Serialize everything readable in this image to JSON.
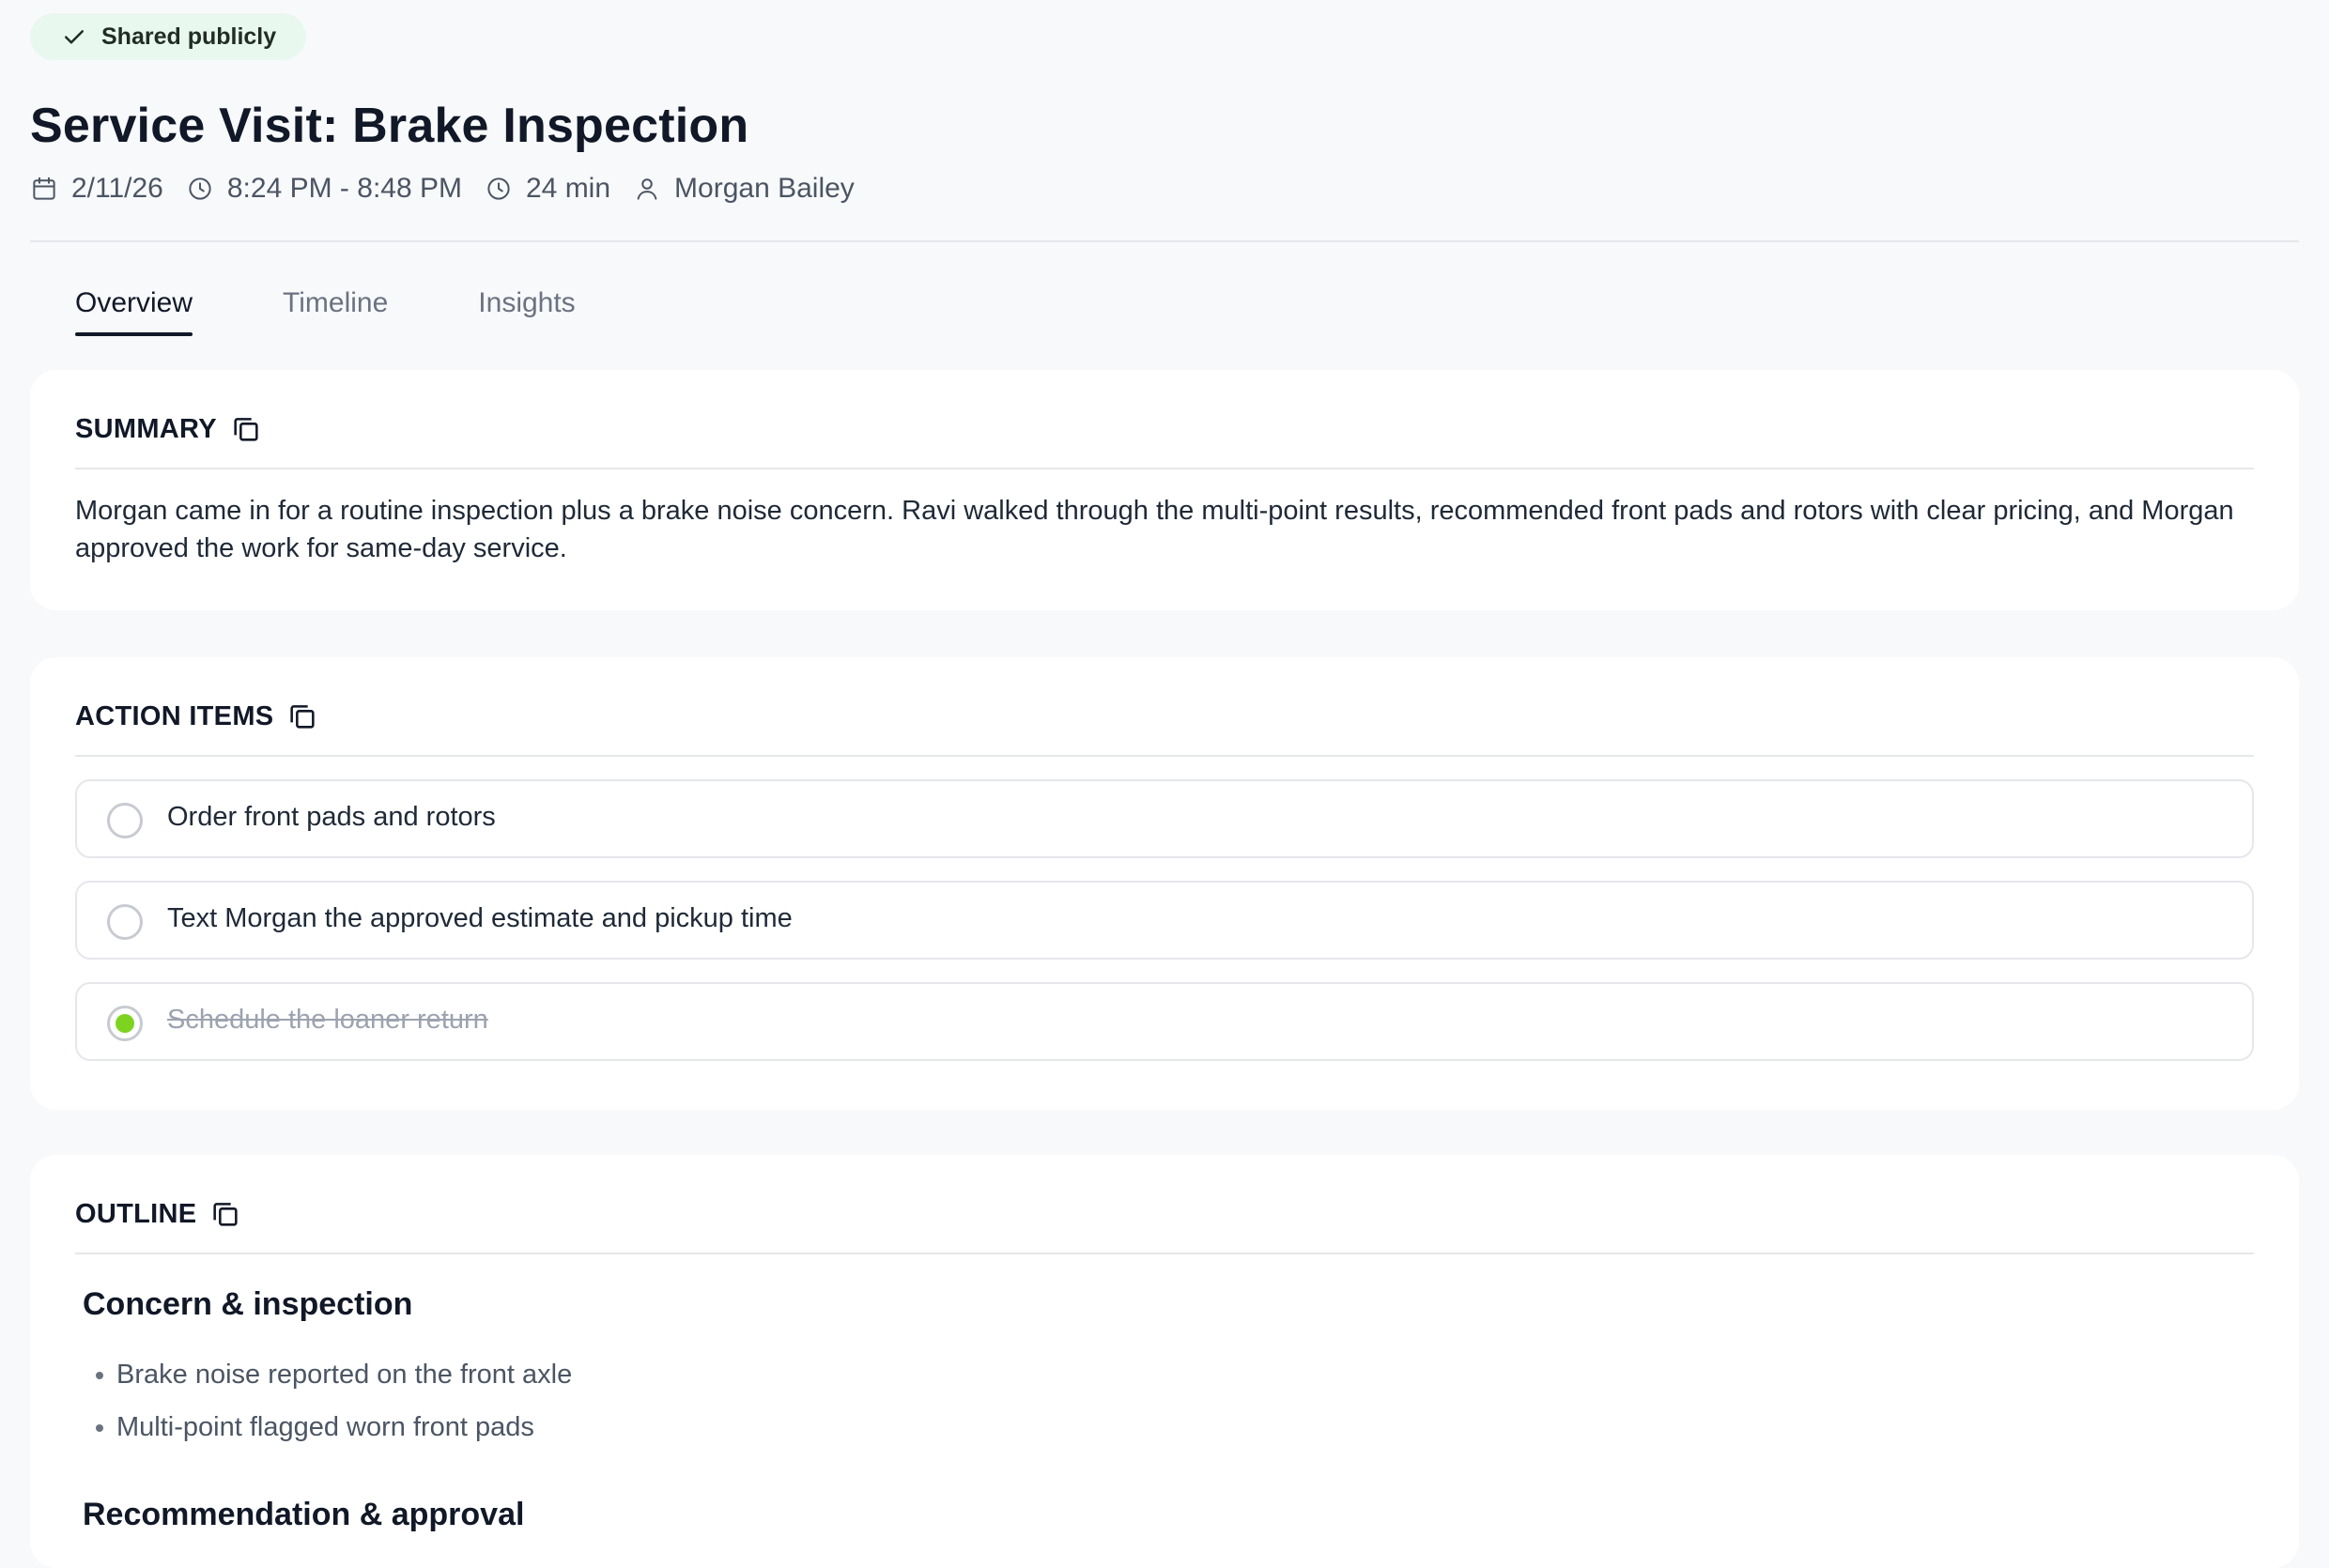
{
  "badge": {
    "label": "Shared publicly"
  },
  "title": "Service Visit: Brake Inspection",
  "meta": {
    "date": "2/11/26",
    "time_range": "8:24 PM - 8:48 PM",
    "duration": "24 min",
    "person": "Morgan Bailey"
  },
  "tabs": [
    {
      "label": "Overview",
      "active": true
    },
    {
      "label": "Timeline",
      "active": false
    },
    {
      "label": "Insights",
      "active": false
    }
  ],
  "summary": {
    "title": "SUMMARY",
    "text": "Morgan came in for a routine inspection plus a brake noise concern. Ravi walked through the multi-point results, recommended front pads and rotors with clear pricing, and Morgan approved the work for same-day service."
  },
  "action_items": {
    "title": "ACTION ITEMS",
    "items": [
      {
        "label": "Order front pads and rotors",
        "done": false
      },
      {
        "label": "Text Morgan the approved estimate and pickup time",
        "done": false
      },
      {
        "label": "Schedule the loaner return",
        "done": true
      }
    ]
  },
  "outline": {
    "title": "OUTLINE",
    "sections": [
      {
        "heading": "Concern & inspection",
        "bullets": [
          "Brake noise reported on the front axle",
          "Multi-point flagged worn front pads"
        ]
      },
      {
        "heading": "Recommendation & approval",
        "bullets": []
      }
    ]
  },
  "colors": {
    "background": "#f8f9fb",
    "badge_bg": "#e9f8ef",
    "check_done": "#7ed321",
    "text_primary": "#111827",
    "text_muted": "#6b7280"
  },
  "icons": {
    "badge": "check-icon",
    "date": "calendar-icon",
    "time": "clock-icon",
    "duration": "clock-icon",
    "person": "user-icon",
    "copy": "copy-icon"
  }
}
